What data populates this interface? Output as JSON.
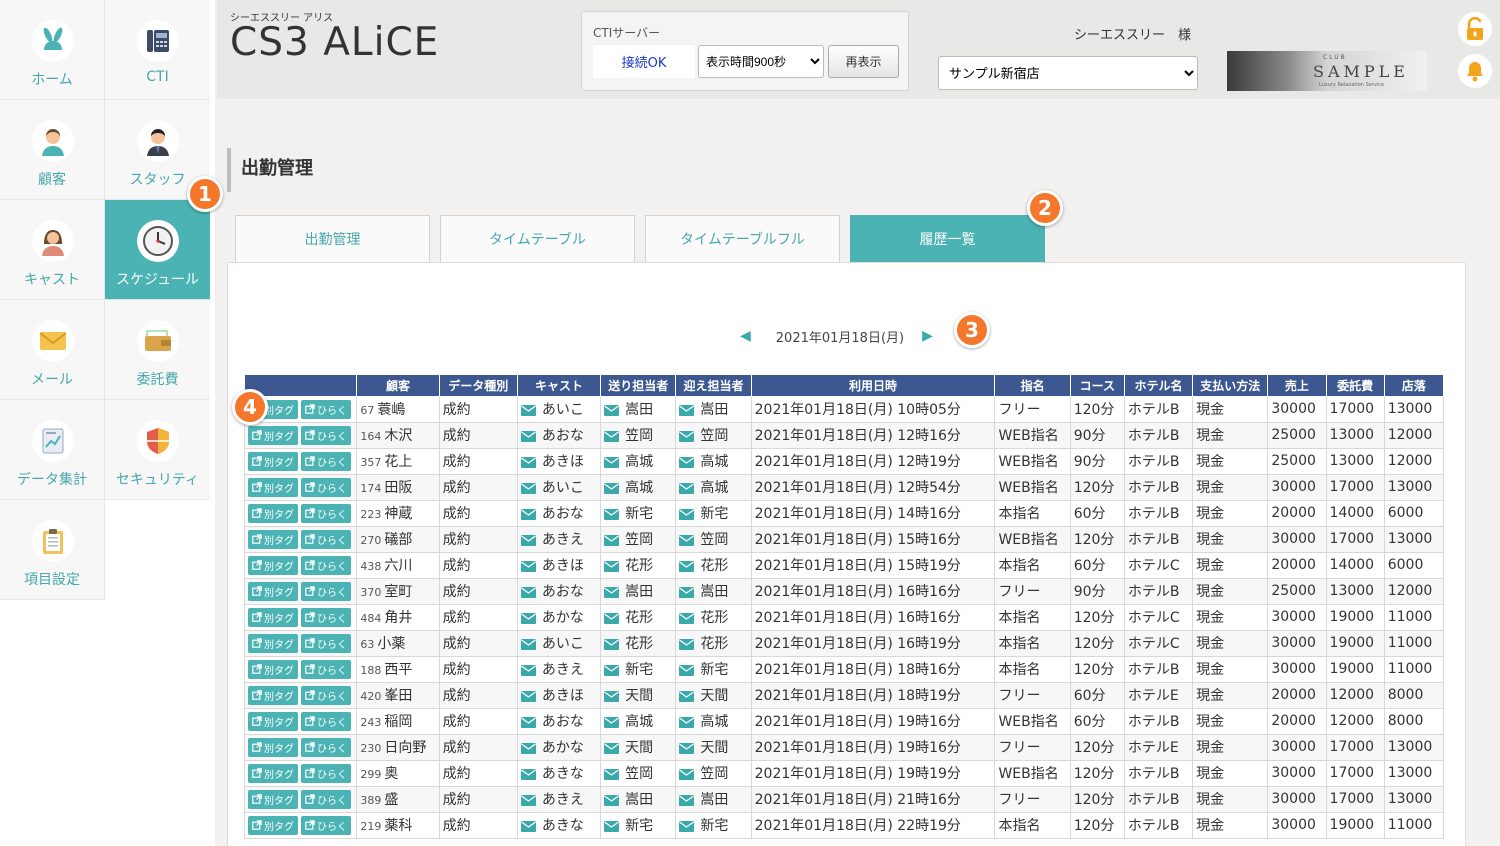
{
  "sidebar": {
    "items": [
      {
        "label": "ホーム",
        "icon": "bunny-icon"
      },
      {
        "label": "CTI",
        "icon": "fax-icon"
      },
      {
        "label": "顧客",
        "icon": "customer-icon"
      },
      {
        "label": "スタッフ",
        "icon": "staff-icon"
      },
      {
        "label": "キャスト",
        "icon": "cast-icon"
      },
      {
        "label": "スケジュール",
        "icon": "clock-icon"
      },
      {
        "label": "メール",
        "icon": "mail-icon"
      },
      {
        "label": "委託費",
        "icon": "wallet-icon"
      },
      {
        "label": "データ集計",
        "icon": "report-icon"
      },
      {
        "label": "セキュリティ",
        "icon": "shield-icon"
      },
      {
        "label": "項目設定",
        "icon": "clipboard-icon"
      }
    ]
  },
  "header": {
    "sub_title": "シーエススリー アリス",
    "logo": "CS3 ALiCE",
    "cti_title": "CTIサーバー",
    "cti_status": "接続OK",
    "display_time": "表示時間900秒",
    "reload_label": "再表示",
    "user_name": "シーエススリー　様",
    "shop": "サンプル新宿店",
    "banner_small": "CLUB",
    "banner_name": "SAMPLE",
    "banner_tag": "Luxury Relaxation Service"
  },
  "page": {
    "title": "出勤管理"
  },
  "tabs": [
    "出勤管理",
    "タイムテーブル",
    "タイムテーブルフル",
    "履歴一覧"
  ],
  "date_label": "2021年01月18日(月)",
  "badges": [
    "1",
    "2",
    "3",
    "4"
  ],
  "table": {
    "columns": [
      "",
      "顧客",
      "データ種別",
      "キャスト",
      "送り担当者",
      "迎え担当者",
      "利用日時",
      "指名",
      "コース",
      "ホテル名",
      "支払い方法",
      "売上",
      "委託費",
      "店落"
    ],
    "btn_tab": "別タグ",
    "btn_open": "ひらく",
    "rows": [
      {
        "no": "67",
        "name": "蓑嶋",
        "type": "成約",
        "cast": "あいこ",
        "send": "嵩田",
        "pick": "嵩田",
        "date": "2021年01月18日(月) 10時05分",
        "nom": "フリー",
        "course": "120分",
        "hotel": "ホテルB",
        "pay": "現金",
        "sales": "30000",
        "fee": "17000",
        "shop": "13000"
      },
      {
        "no": "164",
        "name": "木沢",
        "type": "成約",
        "cast": "あおな",
        "send": "笠岡",
        "pick": "笠岡",
        "date": "2021年01月18日(月) 12時16分",
        "nom": "WEB指名",
        "course": "90分",
        "hotel": "ホテルB",
        "pay": "現金",
        "sales": "25000",
        "fee": "13000",
        "shop": "12000"
      },
      {
        "no": "357",
        "name": "花上",
        "type": "成約",
        "cast": "あきほ",
        "send": "高城",
        "pick": "高城",
        "date": "2021年01月18日(月) 12時19分",
        "nom": "WEB指名",
        "course": "90分",
        "hotel": "ホテルB",
        "pay": "現金",
        "sales": "25000",
        "fee": "13000",
        "shop": "12000"
      },
      {
        "no": "174",
        "name": "田阪",
        "type": "成約",
        "cast": "あいこ",
        "send": "高城",
        "pick": "高城",
        "date": "2021年01月18日(月) 12時54分",
        "nom": "WEB指名",
        "course": "120分",
        "hotel": "ホテルB",
        "pay": "現金",
        "sales": "30000",
        "fee": "17000",
        "shop": "13000"
      },
      {
        "no": "223",
        "name": "神蔵",
        "type": "成約",
        "cast": "あおな",
        "send": "新宅",
        "pick": "新宅",
        "date": "2021年01月18日(月) 14時16分",
        "nom": "本指名",
        "course": "60分",
        "hotel": "ホテルB",
        "pay": "現金",
        "sales": "20000",
        "fee": "14000",
        "shop": "6000"
      },
      {
        "no": "270",
        "name": "礒部",
        "type": "成約",
        "cast": "あきえ",
        "send": "笠岡",
        "pick": "笠岡",
        "date": "2021年01月18日(月) 15時16分",
        "nom": "WEB指名",
        "course": "120分",
        "hotel": "ホテルB",
        "pay": "現金",
        "sales": "30000",
        "fee": "17000",
        "shop": "13000"
      },
      {
        "no": "438",
        "name": "六川",
        "type": "成約",
        "cast": "あきほ",
        "send": "花形",
        "pick": "花形",
        "date": "2021年01月18日(月) 15時19分",
        "nom": "本指名",
        "course": "60分",
        "hotel": "ホテルC",
        "pay": "現金",
        "sales": "20000",
        "fee": "14000",
        "shop": "6000"
      },
      {
        "no": "370",
        "name": "室町",
        "type": "成約",
        "cast": "あおな",
        "send": "嵩田",
        "pick": "嵩田",
        "date": "2021年01月18日(月) 16時16分",
        "nom": "フリー",
        "course": "90分",
        "hotel": "ホテルB",
        "pay": "現金",
        "sales": "25000",
        "fee": "13000",
        "shop": "12000"
      },
      {
        "no": "484",
        "name": "角井",
        "type": "成約",
        "cast": "あかな",
        "send": "花形",
        "pick": "花形",
        "date": "2021年01月18日(月) 16時16分",
        "nom": "本指名",
        "course": "120分",
        "hotel": "ホテルC",
        "pay": "現金",
        "sales": "30000",
        "fee": "19000",
        "shop": "11000"
      },
      {
        "no": "63",
        "name": "小薬",
        "type": "成約",
        "cast": "あいこ",
        "send": "花形",
        "pick": "花形",
        "date": "2021年01月18日(月) 16時19分",
        "nom": "本指名",
        "course": "120分",
        "hotel": "ホテルC",
        "pay": "現金",
        "sales": "30000",
        "fee": "19000",
        "shop": "11000"
      },
      {
        "no": "188",
        "name": "西平",
        "type": "成約",
        "cast": "あきえ",
        "send": "新宅",
        "pick": "新宅",
        "date": "2021年01月18日(月) 18時16分",
        "nom": "本指名",
        "course": "120分",
        "hotel": "ホテルB",
        "pay": "現金",
        "sales": "30000",
        "fee": "19000",
        "shop": "11000"
      },
      {
        "no": "420",
        "name": "峯田",
        "type": "成約",
        "cast": "あきほ",
        "send": "天間",
        "pick": "天間",
        "date": "2021年01月18日(月) 18時19分",
        "nom": "フリー",
        "course": "60分",
        "hotel": "ホテルE",
        "pay": "現金",
        "sales": "20000",
        "fee": "12000",
        "shop": "8000"
      },
      {
        "no": "243",
        "name": "稲岡",
        "type": "成約",
        "cast": "あおな",
        "send": "高城",
        "pick": "高城",
        "date": "2021年01月18日(月) 19時16分",
        "nom": "WEB指名",
        "course": "60分",
        "hotel": "ホテルB",
        "pay": "現金",
        "sales": "20000",
        "fee": "12000",
        "shop": "8000"
      },
      {
        "no": "230",
        "name": "日向野",
        "type": "成約",
        "cast": "あかな",
        "send": "天間",
        "pick": "天間",
        "date": "2021年01月18日(月) 19時16分",
        "nom": "フリー",
        "course": "120分",
        "hotel": "ホテルE",
        "pay": "現金",
        "sales": "30000",
        "fee": "17000",
        "shop": "13000"
      },
      {
        "no": "299",
        "name": "奥",
        "type": "成約",
        "cast": "あきな",
        "send": "笠岡",
        "pick": "笠岡",
        "date": "2021年01月18日(月) 19時19分",
        "nom": "WEB指名",
        "course": "120分",
        "hotel": "ホテルB",
        "pay": "現金",
        "sales": "30000",
        "fee": "17000",
        "shop": "13000"
      },
      {
        "no": "389",
        "name": "盛",
        "type": "成約",
        "cast": "あきえ",
        "send": "嵩田",
        "pick": "嵩田",
        "date": "2021年01月18日(月) 21時16分",
        "nom": "フリー",
        "course": "120分",
        "hotel": "ホテルB",
        "pay": "現金",
        "sales": "30000",
        "fee": "17000",
        "shop": "13000"
      },
      {
        "no": "219",
        "name": "薬科",
        "type": "成約",
        "cast": "あきな",
        "send": "新宅",
        "pick": "新宅",
        "date": "2021年01月18日(月) 22時19分",
        "nom": "本指名",
        "course": "120分",
        "hotel": "ホテルB",
        "pay": "現金",
        "sales": "30000",
        "fee": "19000",
        "shop": "11000"
      }
    ]
  }
}
